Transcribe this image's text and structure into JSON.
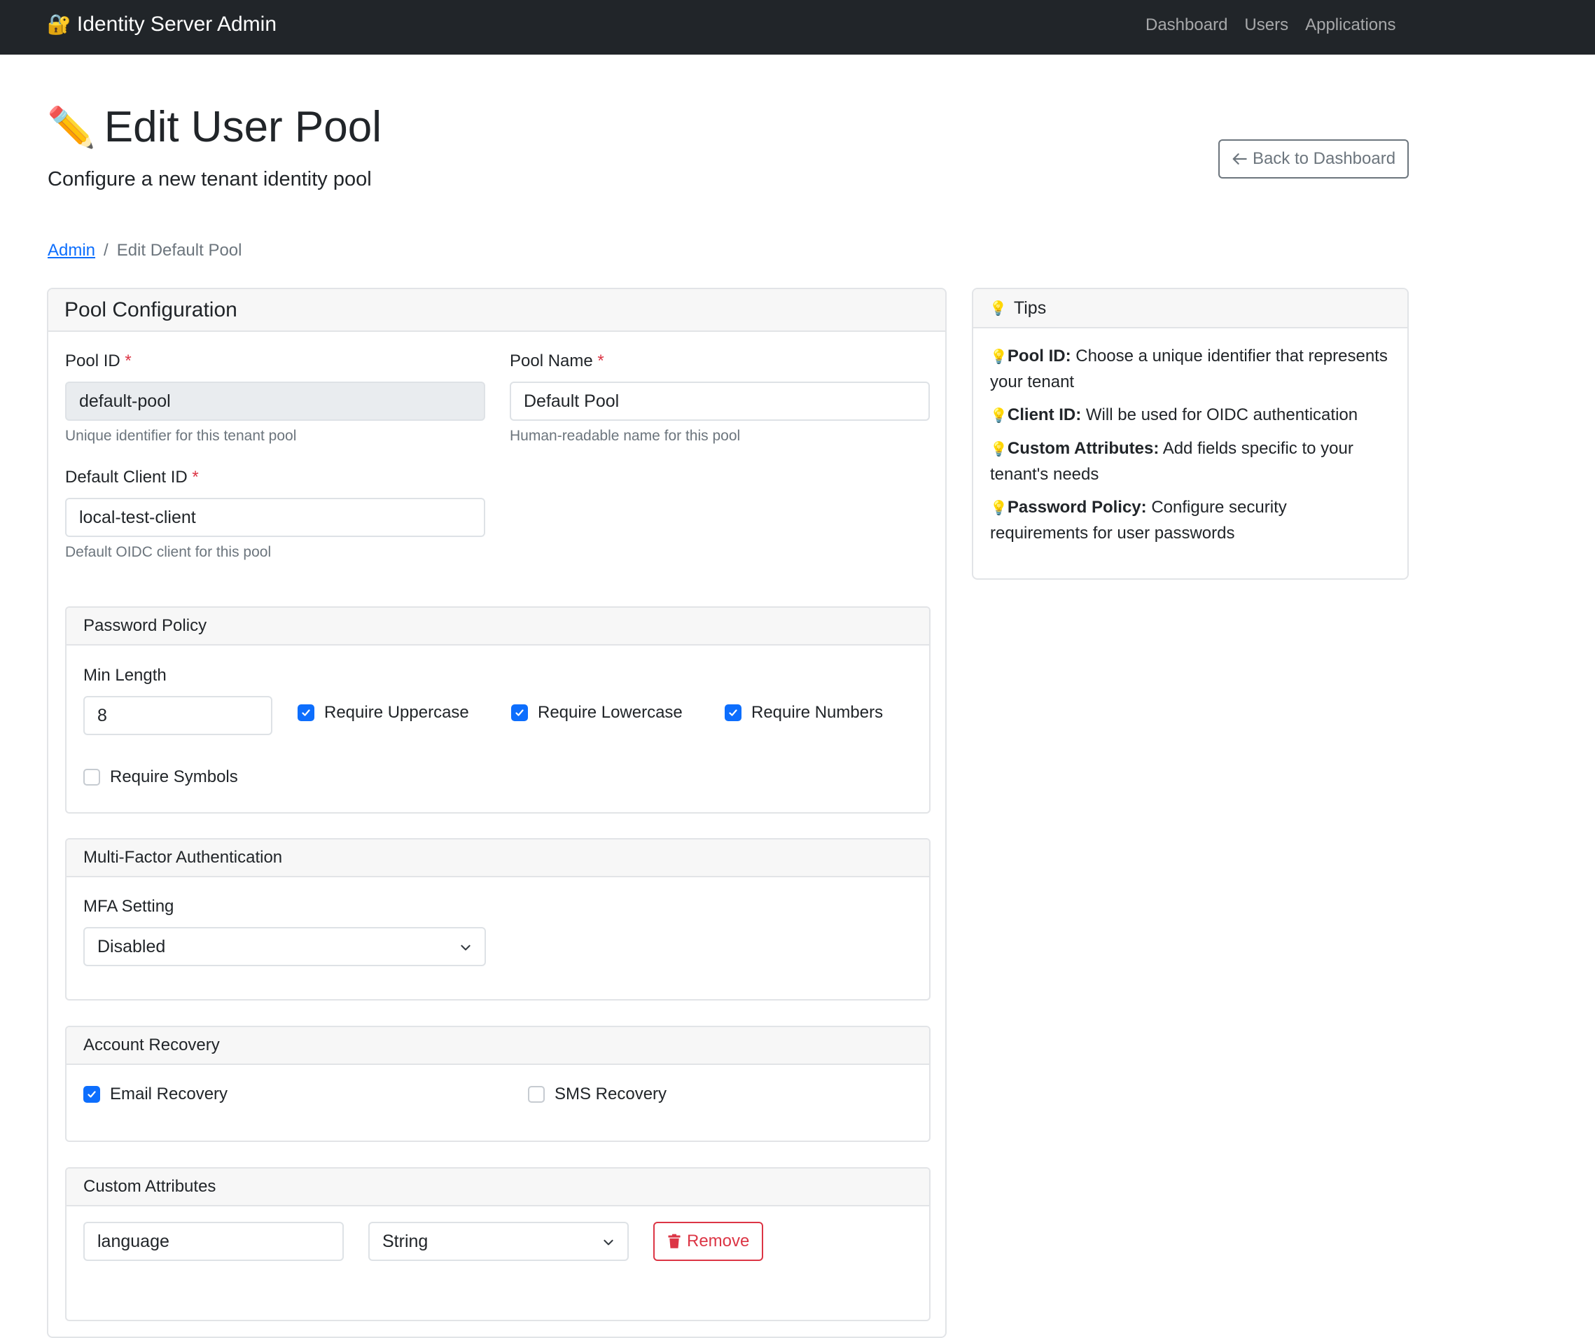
{
  "navbar": {
    "brand": "Identity Server Admin",
    "brand_icon": "lock-key-icon",
    "links": [
      "Dashboard",
      "Users",
      "Applications"
    ]
  },
  "header": {
    "title": "Edit User Pool",
    "title_icon": "pencil-icon",
    "subtitle": "Configure a new tenant identity pool",
    "back_button": "Back to Dashboard"
  },
  "breadcrumb": {
    "root": "Admin",
    "separator": "/",
    "current": "Edit Default Pool"
  },
  "pool_config": {
    "title": "Pool Configuration",
    "pool_id": {
      "label": "Pool ID",
      "required": "*",
      "value": "default-pool",
      "help": "Unique identifier for this tenant pool"
    },
    "pool_name": {
      "label": "Pool Name",
      "required": "*",
      "value": "Default Pool",
      "help": "Human-readable name for this pool"
    },
    "client_id": {
      "label": "Default Client ID",
      "required": "*",
      "value": "local-test-client",
      "help": "Default OIDC client for this pool"
    }
  },
  "password_policy": {
    "title": "Password Policy",
    "min_length_label": "Min Length",
    "min_length_value": "8",
    "options": [
      {
        "label": "Require Uppercase",
        "checked": true
      },
      {
        "label": "Require Lowercase",
        "checked": true
      },
      {
        "label": "Require Numbers",
        "checked": true
      },
      {
        "label": "Require Symbols",
        "checked": false
      }
    ]
  },
  "mfa": {
    "title": "Multi-Factor Authentication",
    "label": "MFA Setting",
    "value": "Disabled"
  },
  "recovery": {
    "title": "Account Recovery",
    "options": [
      {
        "label": "Email Recovery",
        "checked": true
      },
      {
        "label": "SMS Recovery",
        "checked": false
      }
    ]
  },
  "custom_attributes": {
    "title": "Custom Attributes",
    "rows": [
      {
        "name": "language",
        "type": "String",
        "remove_label": "Remove"
      }
    ]
  },
  "tips": {
    "title": "Tips",
    "items": [
      {
        "term": "Pool ID:",
        "text": "Choose a unique identifier that represents your tenant"
      },
      {
        "term": "Client ID:",
        "text": "Will be used for OIDC authentication"
      },
      {
        "term": "Custom Attributes:",
        "text": "Add fields specific to your tenant's needs"
      },
      {
        "term": "Password Policy:",
        "text": "Configure security requirements for user passwords"
      }
    ]
  },
  "colors": {
    "primary": "#0d6efd",
    "danger": "#dc3545",
    "navbar": "#212529",
    "muted": "#6c757d"
  }
}
